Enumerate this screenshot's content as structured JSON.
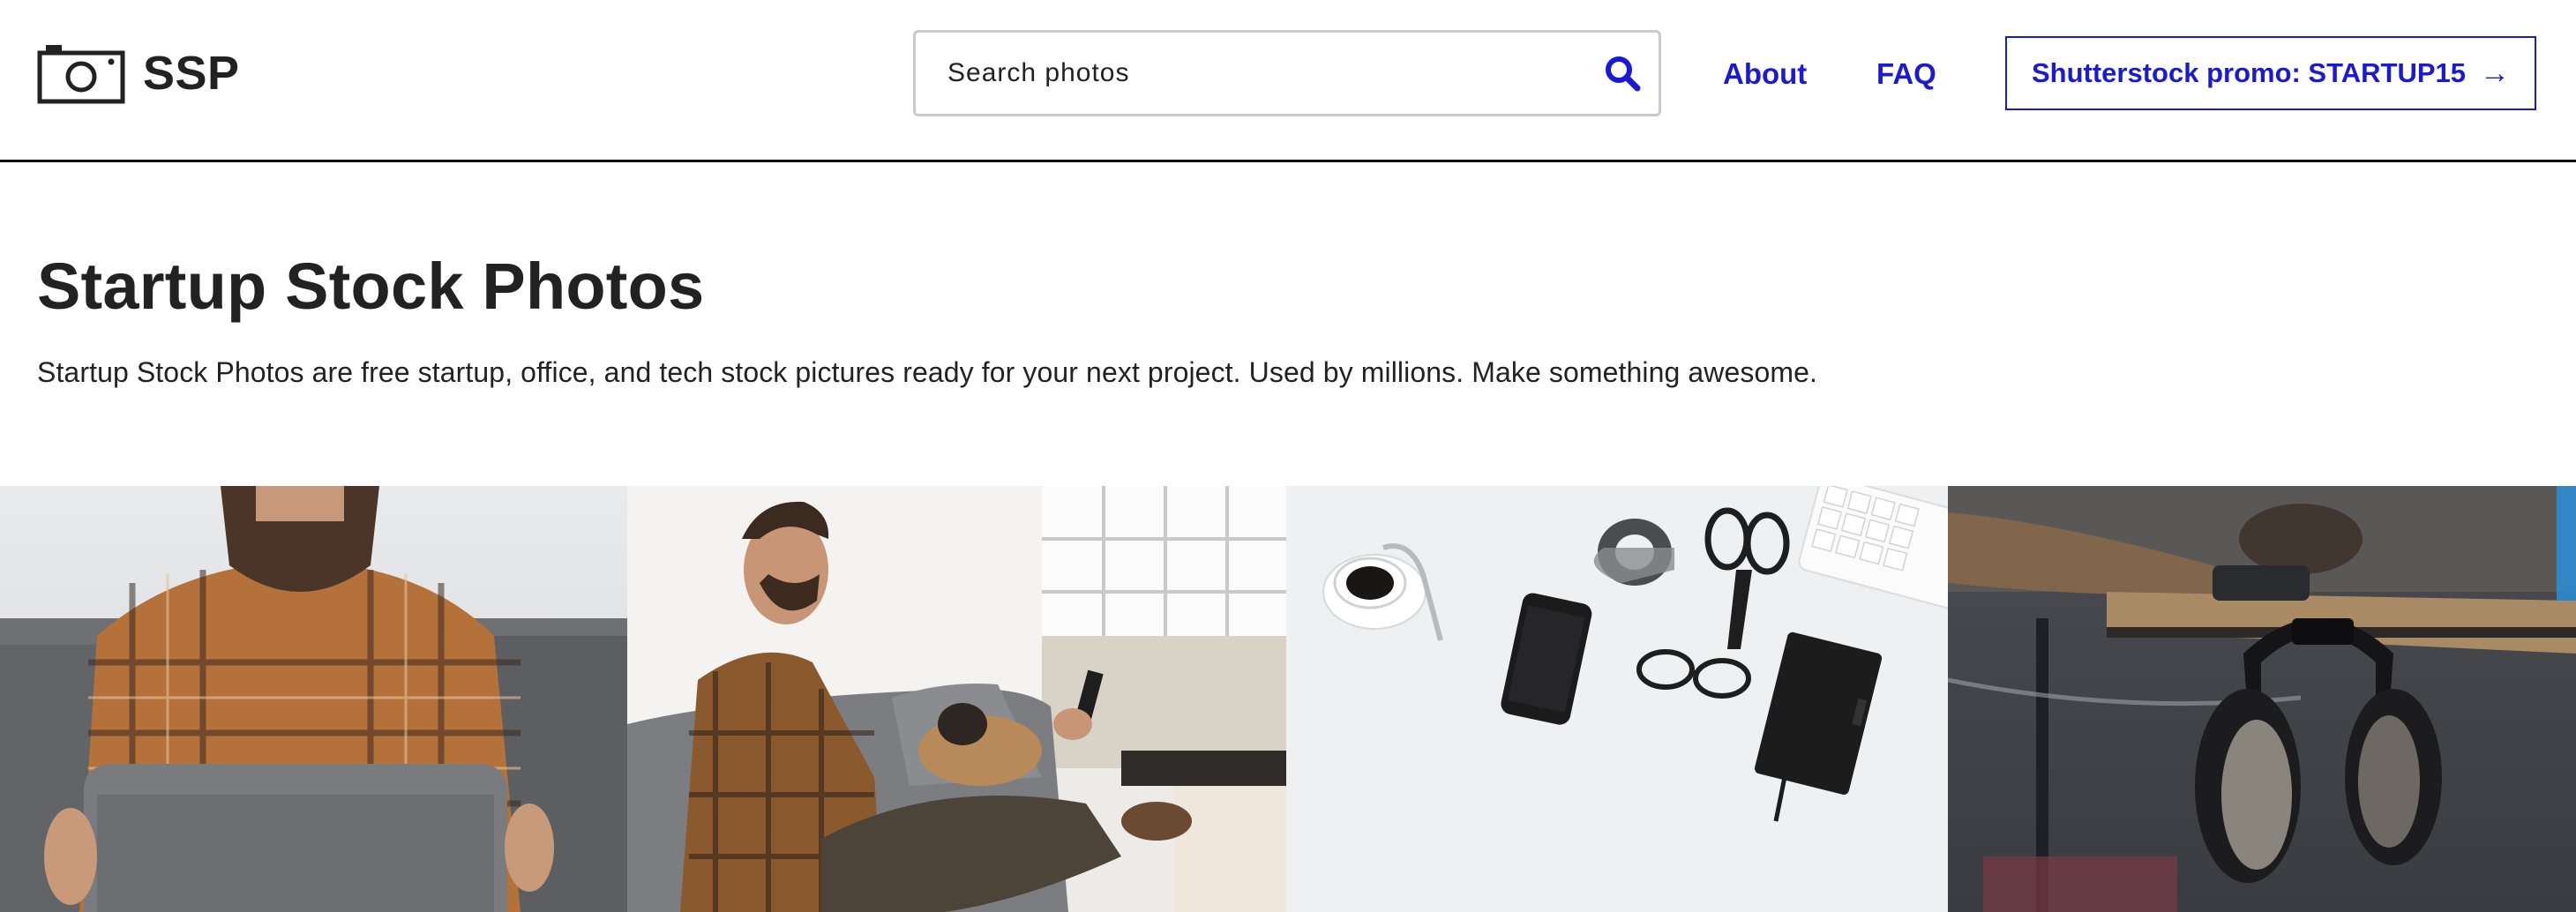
{
  "brand": {
    "name": "SSP",
    "logo_icon": "camera-icon"
  },
  "search": {
    "placeholder": "Search photos",
    "icon": "search-icon"
  },
  "nav": {
    "about": "About",
    "faq": "FAQ"
  },
  "promo": {
    "label": "Shutterstock promo: STARTUP15",
    "arrow": "→"
  },
  "hero": {
    "title": "Startup Stock Photos",
    "subtitle": "Startup Stock Photos are free startup, office, and tech stock pictures ready for your next project. Used by millions. Make something awesome."
  },
  "colors": {
    "link": "#1a1ad6",
    "text": "#222222",
    "border": "#111111"
  }
}
